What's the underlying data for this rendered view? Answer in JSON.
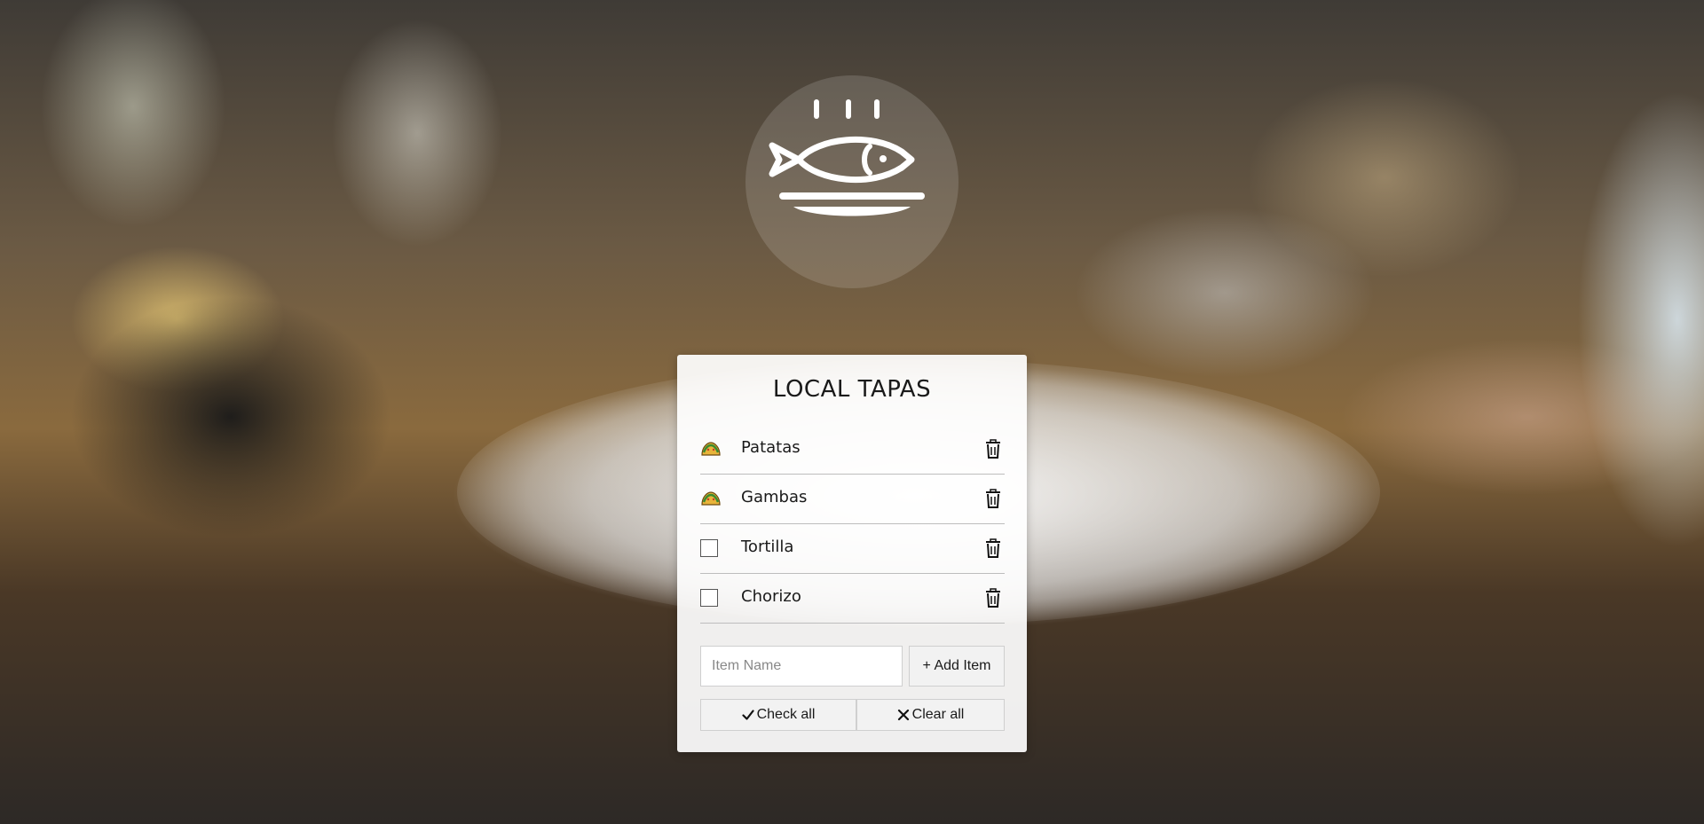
{
  "app": {
    "title": "LOCAL TAPAS"
  },
  "logo": {
    "icon": "fish-plate-icon"
  },
  "items": [
    {
      "label": "Patatas",
      "checked": true,
      "checked_icon": "taco-icon"
    },
    {
      "label": "Gambas",
      "checked": true,
      "checked_icon": "taco-icon"
    },
    {
      "label": "Tortilla",
      "checked": false
    },
    {
      "label": "Chorizo",
      "checked": false
    }
  ],
  "form": {
    "input_placeholder": "Item Name",
    "input_value": "",
    "add_label": "+ Add Item"
  },
  "actions": {
    "check_all_label": "Check all",
    "clear_all_label": "Clear all"
  },
  "colors": {
    "card_background": "#ffffff",
    "text": "#1a1a1a",
    "divider": "#bdbdbd",
    "button_background": "#f2f2f2"
  }
}
